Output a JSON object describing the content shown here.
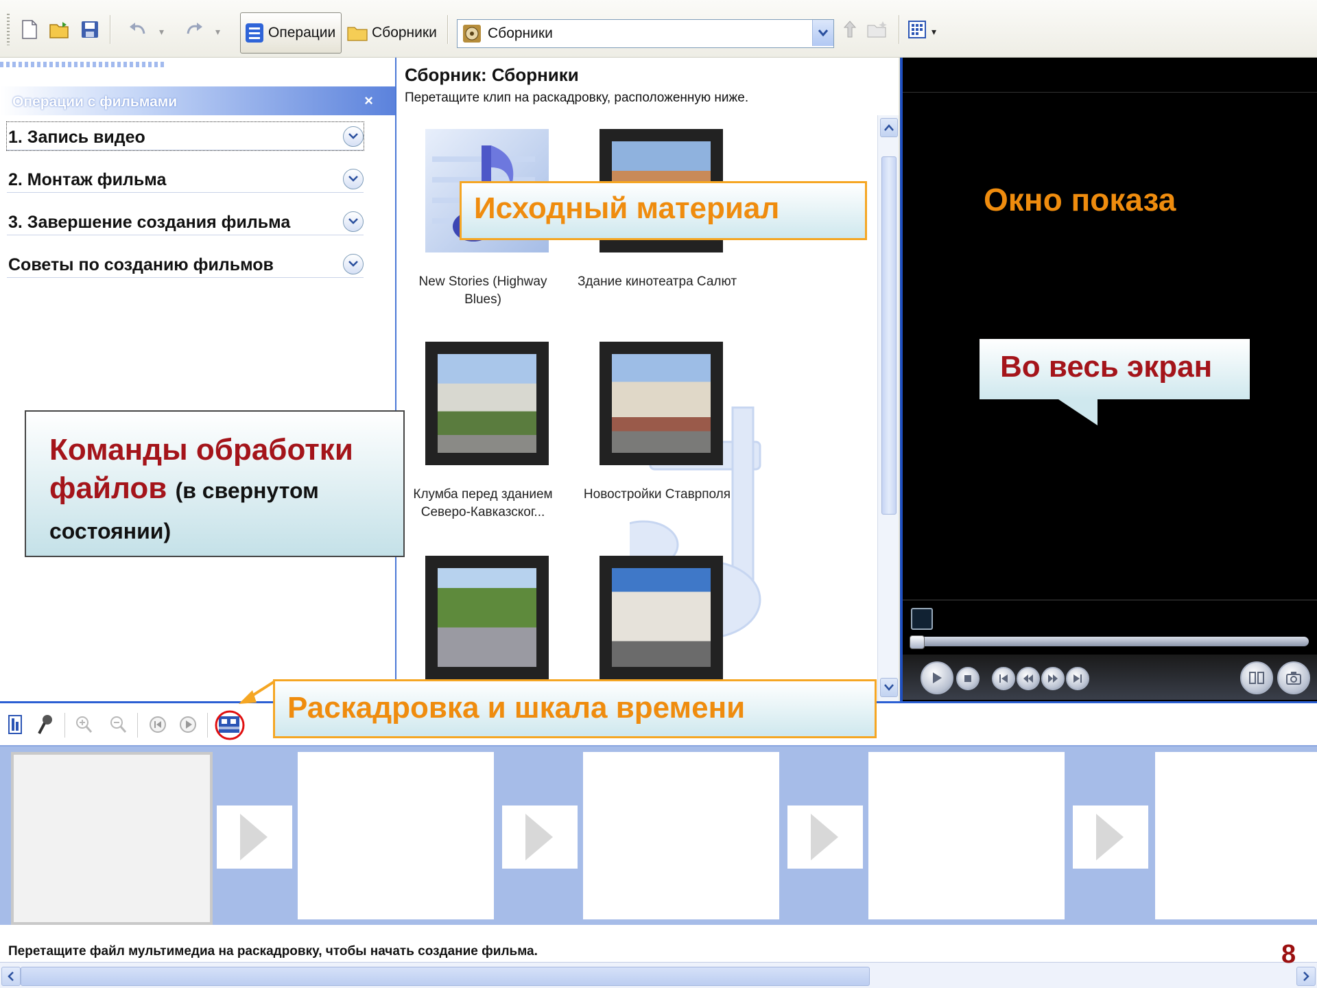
{
  "toolbar": {
    "operations_label": "Операции",
    "collections_button_label": "Сборники",
    "collections_select_value": "Сборники"
  },
  "task_pane": {
    "header": "Операции с фильмами",
    "close_glyph": "×",
    "items": [
      {
        "label": "1. Запись видео"
      },
      {
        "label": "2. Монтаж фильма"
      },
      {
        "label": "3. Завершение создания фильма"
      },
      {
        "label": "Советы по созданию фильмов"
      }
    ]
  },
  "collection": {
    "title": "Сборник: Сборники",
    "hint": "Перетащите клип на раскадровку, расположенную ниже.",
    "clips": [
      {
        "caption": "New Stories (Highway Blues)",
        "kind": "audio"
      },
      {
        "caption": "Здание кинотеатра Салют",
        "kind": "video"
      },
      {
        "caption": "Клумба перед зданием Северо-Кавказског...",
        "kind": "video"
      },
      {
        "caption": "Новостройки Ставрполя",
        "kind": "video"
      },
      {
        "caption": "",
        "kind": "video"
      },
      {
        "caption": "",
        "kind": "video"
      }
    ]
  },
  "annotations": {
    "source_material": "Исходный материал",
    "preview_window": "Окно показа",
    "fullscreen": "Во весь экран",
    "commands_main": "Команды обработки файлов",
    "commands_note": "(в свернутом состоянии)",
    "storyboard": "Раскадровка и шкала времени"
  },
  "status": {
    "text": "Перетащите файл мультимедиа на раскадровку, чтобы начать создание фильма."
  },
  "page_number": "8",
  "colors": {
    "accent_blue": "#2b5fd3",
    "callout_orange": "#ef8c0e",
    "callout_red": "#a4141a",
    "storyboard_bg": "#a6bce8"
  }
}
